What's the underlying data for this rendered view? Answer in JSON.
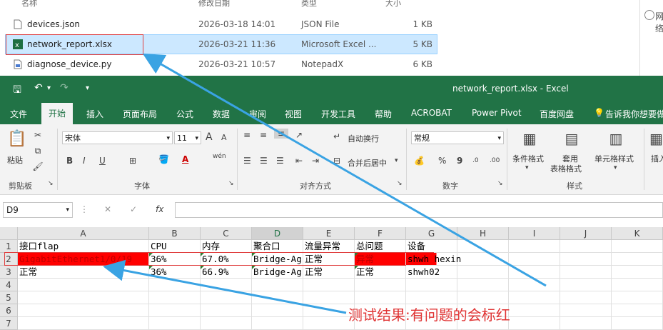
{
  "explorer": {
    "headers": {
      "name": "名称",
      "date": "修改日期",
      "type": "类型",
      "size": "大小"
    },
    "files": [
      {
        "icon": "file-icon",
        "name": "devices.json",
        "date": "2026-03-18 14:01",
        "type": "JSON File",
        "size": "1 KB"
      },
      {
        "icon": "excel-file-icon",
        "name": "network_report.xlsx",
        "date": "2026-03-21 11:36",
        "type": "Microsoft Excel ...",
        "size": "5 KB"
      },
      {
        "icon": "notepadx-file-icon",
        "name": "diagnose_device.py",
        "date": "2026-03-21 10:57",
        "type": "NotepadX",
        "size": "6 KB"
      }
    ],
    "side_text": "网络"
  },
  "excel": {
    "title": "network_report.xlsx  -  Excel",
    "qat": {
      "save": "🖫",
      "undo": "↶",
      "redo": "↷",
      "more": "▾"
    },
    "tabs": [
      "文件",
      "开始",
      "插入",
      "页面布局",
      "公式",
      "数据",
      "审阅",
      "视图",
      "开发工具",
      "帮助",
      "ACROBAT",
      "Power Pivot",
      "百度网盘",
      "告诉我你想要做"
    ],
    "ribbon": {
      "paste_label": "粘贴",
      "clipboard_label": "剪贴板",
      "font_name": "宋体",
      "font_size": "11",
      "font_label": "字体",
      "wrap_text": "自动换行",
      "merge_center": "合并后居中",
      "align_label": "对齐方式",
      "number_format": "常规",
      "number_label": "数字",
      "cond_format": "条件格式",
      "table_format_1": "套用",
      "table_format_2": "表格格式",
      "cell_style": "单元格样式",
      "insert": "插入",
      "styles_label": "样式",
      "bold": "B",
      "italic": "I",
      "underline": "U",
      "percent": "%",
      "comma": "9",
      "wen": "wén",
      "font_grow": "A",
      "font_shrink": "A"
    },
    "formula_bar": {
      "name_box": "D9",
      "fx": "fx",
      "value": ""
    },
    "columns": [
      "A",
      "B",
      "C",
      "D",
      "E",
      "F",
      "G",
      "H",
      "I",
      "J",
      "K"
    ],
    "rows": [
      {
        "num": "1",
        "cells": [
          "接口flap",
          "CPU",
          "内存",
          "聚合口",
          "流量异常",
          "总问题",
          "设备",
          "",
          "",
          "",
          ""
        ]
      },
      {
        "num": "2",
        "cells": [
          "GigabitEthernet1/0/19",
          "36%",
          "67.0%",
          "Bridge-Ag",
          "正常",
          "异常",
          "shwh hexin",
          "",
          "",
          "",
          ""
        ]
      },
      {
        "num": "3",
        "cells": [
          "正常",
          "36%",
          "66.9%",
          "Bridge-Ag",
          "正常",
          "正常",
          "shwh02",
          "",
          "",
          "",
          ""
        ]
      },
      {
        "num": "4",
        "cells": [
          "",
          "",
          "",
          "",
          "",
          "",
          "",
          "",
          "",
          "",
          ""
        ]
      },
      {
        "num": "5",
        "cells": [
          "",
          "",
          "",
          "",
          "",
          "",
          "",
          "",
          "",
          "",
          ""
        ]
      },
      {
        "num": "6",
        "cells": [
          "",
          "",
          "",
          "",
          "",
          "",
          "",
          "",
          "",
          "",
          ""
        ]
      },
      {
        "num": "7",
        "cells": [
          "",
          "",
          "",
          "",
          "",
          "",
          "",
          "",
          "",
          "",
          ""
        ]
      }
    ]
  },
  "annotation": {
    "note": "测试结果:有问题的会标红",
    "color": "#e03535",
    "arrow_color": "#3aa3e3"
  },
  "colors": {
    "excel_green": "#217346",
    "error_red": "#ff0000"
  }
}
